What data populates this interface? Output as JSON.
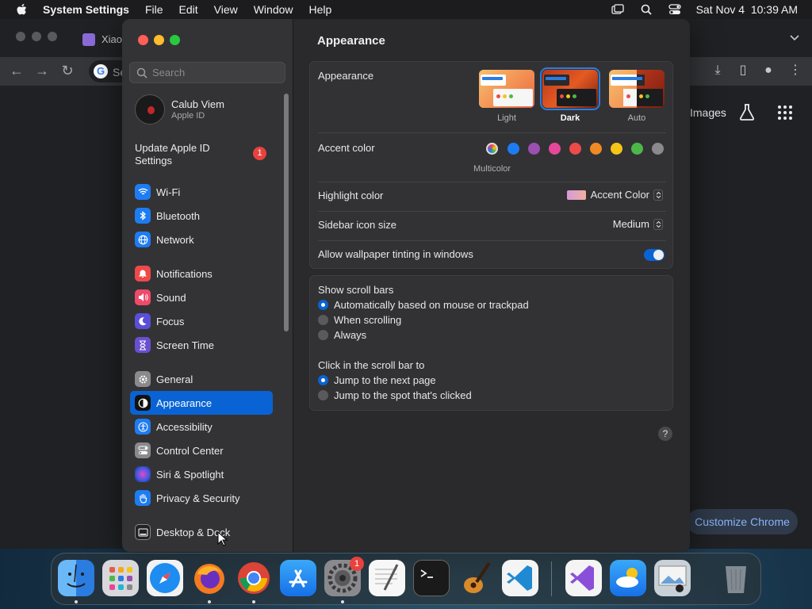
{
  "menubar": {
    "app_name": "System Settings",
    "items": [
      "File",
      "Edit",
      "View",
      "Window",
      "Help"
    ],
    "datetime": "Sat Nov 4  10:39 AM"
  },
  "chrome": {
    "tab_title": "Xiao",
    "omnibox_text": "Se",
    "images_link": "Images",
    "customize_button": "Customize Chrome"
  },
  "settings": {
    "search_placeholder": "Search",
    "account": {
      "name": "Calub Viem",
      "subtitle": "Apple ID"
    },
    "update": {
      "label": "Update Apple ID Settings",
      "badge": "1"
    },
    "sidebar": {
      "group1": [
        {
          "label": "Wi-Fi",
          "icon": "wifi-icon",
          "color": "#1e7cf2"
        },
        {
          "label": "Bluetooth",
          "icon": "bluetooth-icon",
          "color": "#1e7cf2"
        },
        {
          "label": "Network",
          "icon": "globe-icon",
          "color": "#1e7cf2"
        }
      ],
      "group2": [
        {
          "label": "Notifications",
          "icon": "bell-icon",
          "color": "#ee4a4a"
        },
        {
          "label": "Sound",
          "icon": "speaker-icon",
          "color": "#ee4a6a"
        },
        {
          "label": "Focus",
          "icon": "moon-icon",
          "color": "#5b4fd9"
        },
        {
          "label": "Screen Time",
          "icon": "hourglass-icon",
          "color": "#6a4fd0"
        }
      ],
      "group3": [
        {
          "label": "General",
          "icon": "gear-icon",
          "color": "#8a8a8e"
        },
        {
          "label": "Appearance",
          "icon": "appearance-icon",
          "color": "#111111",
          "active": true
        },
        {
          "label": "Accessibility",
          "icon": "accessibility-icon",
          "color": "#1e7cf2"
        },
        {
          "label": "Control Center",
          "icon": "control-center-icon",
          "color": "#8a8a8e"
        },
        {
          "label": "Siri & Spotlight",
          "icon": "siri-icon",
          "color": "#b03fb0"
        },
        {
          "label": "Privacy & Security",
          "icon": "hand-icon",
          "color": "#1e7cf2"
        }
      ],
      "group4": [
        {
          "label": "Desktop & Dock",
          "icon": "dock-icon",
          "color": "#222222"
        }
      ]
    },
    "main": {
      "title": "Appearance",
      "appearance_label": "Appearance",
      "modes": [
        {
          "label": "Light",
          "selected": false
        },
        {
          "label": "Dark",
          "selected": true
        },
        {
          "label": "Auto",
          "selected": false
        }
      ],
      "accent_label": "Accent color",
      "accent_colors": [
        "#d35cf0",
        "#1e7cf2",
        "#9b4fb0",
        "#e6479a",
        "#ee4a4a",
        "#f08a24",
        "#f5c518",
        "#4db84a",
        "#8a8a8e"
      ],
      "accent_selected_name": "Multicolor",
      "highlight_label": "Highlight color",
      "highlight_value": "Accent Color",
      "sidebar_icon_label": "Sidebar icon size",
      "sidebar_icon_value": "Medium",
      "tinting_label": "Allow wallpaper tinting in windows",
      "tinting_on": true,
      "scrollbars_label": "Show scroll bars",
      "scrollbar_options": [
        {
          "label": "Automatically based on mouse or trackpad",
          "selected": true
        },
        {
          "label": "When scrolling",
          "selected": false
        },
        {
          "label": "Always",
          "selected": false
        }
      ],
      "click_label": "Click in the scroll bar to",
      "click_options": [
        {
          "label": "Jump to the next page",
          "selected": true
        },
        {
          "label": "Jump to the spot that's clicked",
          "selected": false
        }
      ],
      "help": "?"
    }
  },
  "dock": {
    "apps": [
      "Finder",
      "Launchpad",
      "Safari",
      "Firefox",
      "Chrome",
      "App Store",
      "System Settings",
      "TextEdit",
      "Terminal",
      "GarageBand",
      "Visual Studio Code",
      "Visual Studio",
      "Weather",
      "Preview",
      "Trash"
    ],
    "settings_badge": "1"
  }
}
